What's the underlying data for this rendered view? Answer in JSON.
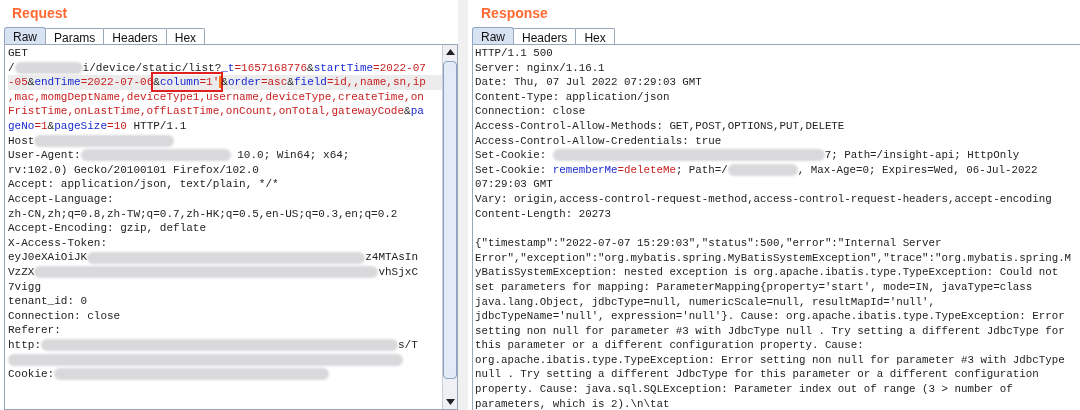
{
  "request": {
    "title": "Request",
    "tabs": [
      {
        "label": "Raw",
        "selected": true
      },
      {
        "label": "Params",
        "selected": false
      },
      {
        "label": "Headers",
        "selected": false
      },
      {
        "label": "Hex",
        "selected": false
      }
    ],
    "lines": [
      {
        "current": false,
        "segments": [
          {
            "kind": "plain",
            "text": "GET"
          }
        ]
      },
      {
        "current": false,
        "segments": [
          {
            "kind": "plain",
            "text": "/"
          },
          {
            "kind": "redacted"
          },
          {
            "kind": "plain",
            "text": "i/device/static/list?"
          },
          {
            "kind": "key",
            "text": "_t"
          },
          {
            "kind": "value",
            "text": "=1657168776"
          },
          {
            "kind": "plain",
            "text": "&"
          },
          {
            "kind": "key",
            "text": "startTime"
          },
          {
            "kind": "value",
            "text": "=2022-07"
          }
        ]
      },
      {
        "current": true,
        "segments": [
          {
            "kind": "value",
            "text": "-05"
          },
          {
            "kind": "plain",
            "text": "&"
          },
          {
            "kind": "key",
            "text": "endTime"
          },
          {
            "kind": "value",
            "text": "=2022-07-06"
          },
          {
            "kind": "frame",
            "segments": [
              {
                "kind": "plain",
                "text": "&"
              },
              {
                "kind": "key",
                "text": "column"
              },
              {
                "kind": "value",
                "text": "=1'"
              },
              {
                "kind": "cursor"
              }
            ]
          },
          {
            "kind": "plain",
            "text": "&"
          },
          {
            "kind": "key",
            "text": "order"
          },
          {
            "kind": "value",
            "text": "=asc"
          },
          {
            "kind": "plain",
            "text": "&"
          },
          {
            "kind": "key",
            "text": "field"
          },
          {
            "kind": "value",
            "text": "=id,,name,sn,ip"
          }
        ]
      },
      {
        "current": false,
        "segments": [
          {
            "kind": "value",
            "text": ",mac,momgDeptName,deviceType1,username,deviceType,createTime,on"
          }
        ]
      },
      {
        "current": false,
        "segments": [
          {
            "kind": "value",
            "text": "FristTime,onLastTime,offLastTime,onCount,onTotal,gatewayCode"
          },
          {
            "kind": "plain",
            "text": "&"
          },
          {
            "kind": "key",
            "text": "pa"
          }
        ]
      },
      {
        "current": false,
        "segments": [
          {
            "kind": "key",
            "text": "geNo"
          },
          {
            "kind": "value",
            "text": "=1"
          },
          {
            "kind": "plain",
            "text": "&"
          },
          {
            "kind": "key",
            "text": "pageSize"
          },
          {
            "kind": "value",
            "text": "=10"
          },
          {
            "kind": "plain",
            "text": " HTTP/1.1"
          }
        ]
      },
      {
        "current": false,
        "segments": [
          {
            "kind": "plain",
            "text": "Host"
          },
          {
            "kind": "redacted"
          }
        ]
      },
      {
        "current": false,
        "segments": [
          {
            "kind": "plain",
            "text": "User-Agent:"
          },
          {
            "kind": "redacted"
          },
          {
            "kind": "plain",
            "text": " 10.0; Win64; x64;"
          }
        ]
      },
      {
        "current": false,
        "segments": [
          {
            "kind": "plain",
            "text": "rv:102.0) Gecko/20100101 Firefox/102.0"
          }
        ]
      },
      {
        "current": false,
        "segments": [
          {
            "kind": "plain",
            "text": "Accept: application/json, text/plain, */*"
          }
        ]
      },
      {
        "current": false,
        "segments": [
          {
            "kind": "plain",
            "text": "Accept-Language:"
          }
        ]
      },
      {
        "current": false,
        "segments": [
          {
            "kind": "plain",
            "text": "zh-CN,zh;q=0.8,zh-TW;q=0.7,zh-HK;q=0.5,en-US;q=0.3,en;q=0.2"
          }
        ]
      },
      {
        "current": false,
        "segments": [
          {
            "kind": "plain",
            "text": "Accept-Encoding: gzip, deflate"
          }
        ]
      },
      {
        "current": false,
        "segments": [
          {
            "kind": "plain",
            "text": "X-Access-Token:"
          }
        ]
      },
      {
        "current": false,
        "segments": [
          {
            "kind": "plain",
            "text": "eyJ0eXAiOiJK"
          },
          {
            "kind": "redacted"
          },
          {
            "kind": "plain",
            "text": "z4MTAsIn"
          }
        ]
      },
      {
        "current": false,
        "segments": [
          {
            "kind": "plain",
            "text": "VzZX"
          },
          {
            "kind": "redacted"
          },
          {
            "kind": "plain",
            "text": "vhSjxC"
          }
        ]
      },
      {
        "current": false,
        "segments": [
          {
            "kind": "plain",
            "text": "7vigg"
          }
        ]
      },
      {
        "current": false,
        "segments": [
          {
            "kind": "plain",
            "text": "tenant_id: 0"
          }
        ]
      },
      {
        "current": false,
        "segments": [
          {
            "kind": "plain",
            "text": "Connection: close"
          }
        ]
      },
      {
        "current": false,
        "segments": [
          {
            "kind": "plain",
            "text": "Referer:"
          }
        ]
      },
      {
        "current": false,
        "segments": [
          {
            "kind": "plain",
            "text": "http:"
          },
          {
            "kind": "redacted"
          },
          {
            "kind": "plain",
            "text": "s/T"
          }
        ]
      },
      {
        "current": false,
        "segments": [
          {
            "kind": "redacted"
          }
        ]
      },
      {
        "current": false,
        "segments": [
          {
            "kind": "plain",
            "text": "Cookie:"
          },
          {
            "kind": "redacted"
          }
        ]
      }
    ]
  },
  "response": {
    "title": "Response",
    "tabs": [
      {
        "label": "Raw",
        "selected": true
      },
      {
        "label": "Headers",
        "selected": false
      },
      {
        "label": "Hex",
        "selected": false
      }
    ],
    "header_lines": [
      {
        "segments": [
          {
            "kind": "plain",
            "text": "HTTP/1.1 500"
          }
        ]
      },
      {
        "segments": [
          {
            "kind": "plain",
            "text": "Server: nginx/1.16.1"
          }
        ]
      },
      {
        "segments": [
          {
            "kind": "plain",
            "text": "Date: Thu, 07 Jul 2022 07:29:03 GMT"
          }
        ]
      },
      {
        "segments": [
          {
            "kind": "plain",
            "text": "Content-Type: application/json"
          }
        ]
      },
      {
        "segments": [
          {
            "kind": "plain",
            "text": "Connection: close"
          }
        ]
      },
      {
        "segments": [
          {
            "kind": "plain",
            "text": "Access-Control-Allow-Methods: GET,POST,OPTIONS,PUT,DELETE"
          }
        ]
      },
      {
        "segments": [
          {
            "kind": "plain",
            "text": "Access-Control-Allow-Credentials: true"
          }
        ]
      },
      {
        "segments": [
          {
            "kind": "plain",
            "text": "Set-Cookie: "
          },
          {
            "kind": "redacted"
          },
          {
            "kind": "plain",
            "text": "7; Path=/insight-api; HttpOnly"
          }
        ]
      },
      {
        "segments": [
          {
            "kind": "plain",
            "text": "Set-Cookie: "
          },
          {
            "kind": "key",
            "text": "rememberMe"
          },
          {
            "kind": "value",
            "text": "=deleteMe"
          },
          {
            "kind": "plain",
            "text": "; Path=/"
          },
          {
            "kind": "redacted"
          },
          {
            "kind": "plain",
            "text": ", Max-Age=0; Expires=Wed, 06-Jul-2022"
          }
        ]
      },
      {
        "segments": [
          {
            "kind": "plain",
            "text": "07:29:03 GMT"
          }
        ]
      },
      {
        "segments": [
          {
            "kind": "plain",
            "text": "Vary: origin,access-control-request-method,access-control-request-headers,accept-encoding"
          }
        ]
      },
      {
        "segments": [
          {
            "kind": "plain",
            "text": "Content-Length: 20273"
          }
        ]
      }
    ],
    "body_lines": [
      "{\"timestamp\":\"2022-07-07 15:29:03\",\"status\":500,\"error\":\"Internal Server",
      "Error\",\"exception\":\"org.mybatis.spring.MyBatisSystemException\",\"trace\":\"org.mybatis.spring.M",
      "yBatisSystemException: nested exception is org.apache.ibatis.type.TypeException: Could not",
      "set parameters for mapping: ParameterMapping{property='start', mode=IN, javaType=class",
      "java.lang.Object, jdbcType=null, numericScale=null, resultMapId='null',",
      "jdbcTypeName='null', expression='null'}. Cause: org.apache.ibatis.type.TypeException: Error",
      "setting non null for parameter #3 with JdbcType null . Try setting a different JdbcType for",
      "this parameter or a different configuration property. Cause:",
      "org.apache.ibatis.type.TypeException: Error setting non null for parameter #3 with JdbcType",
      "null . Try setting a different JdbcType for this parameter or a different configuration",
      "property. Cause: java.sql.SQLException: Parameter index out of range (3 > number of",
      "parameters, which is 2).\\n\\tat"
    ]
  }
}
